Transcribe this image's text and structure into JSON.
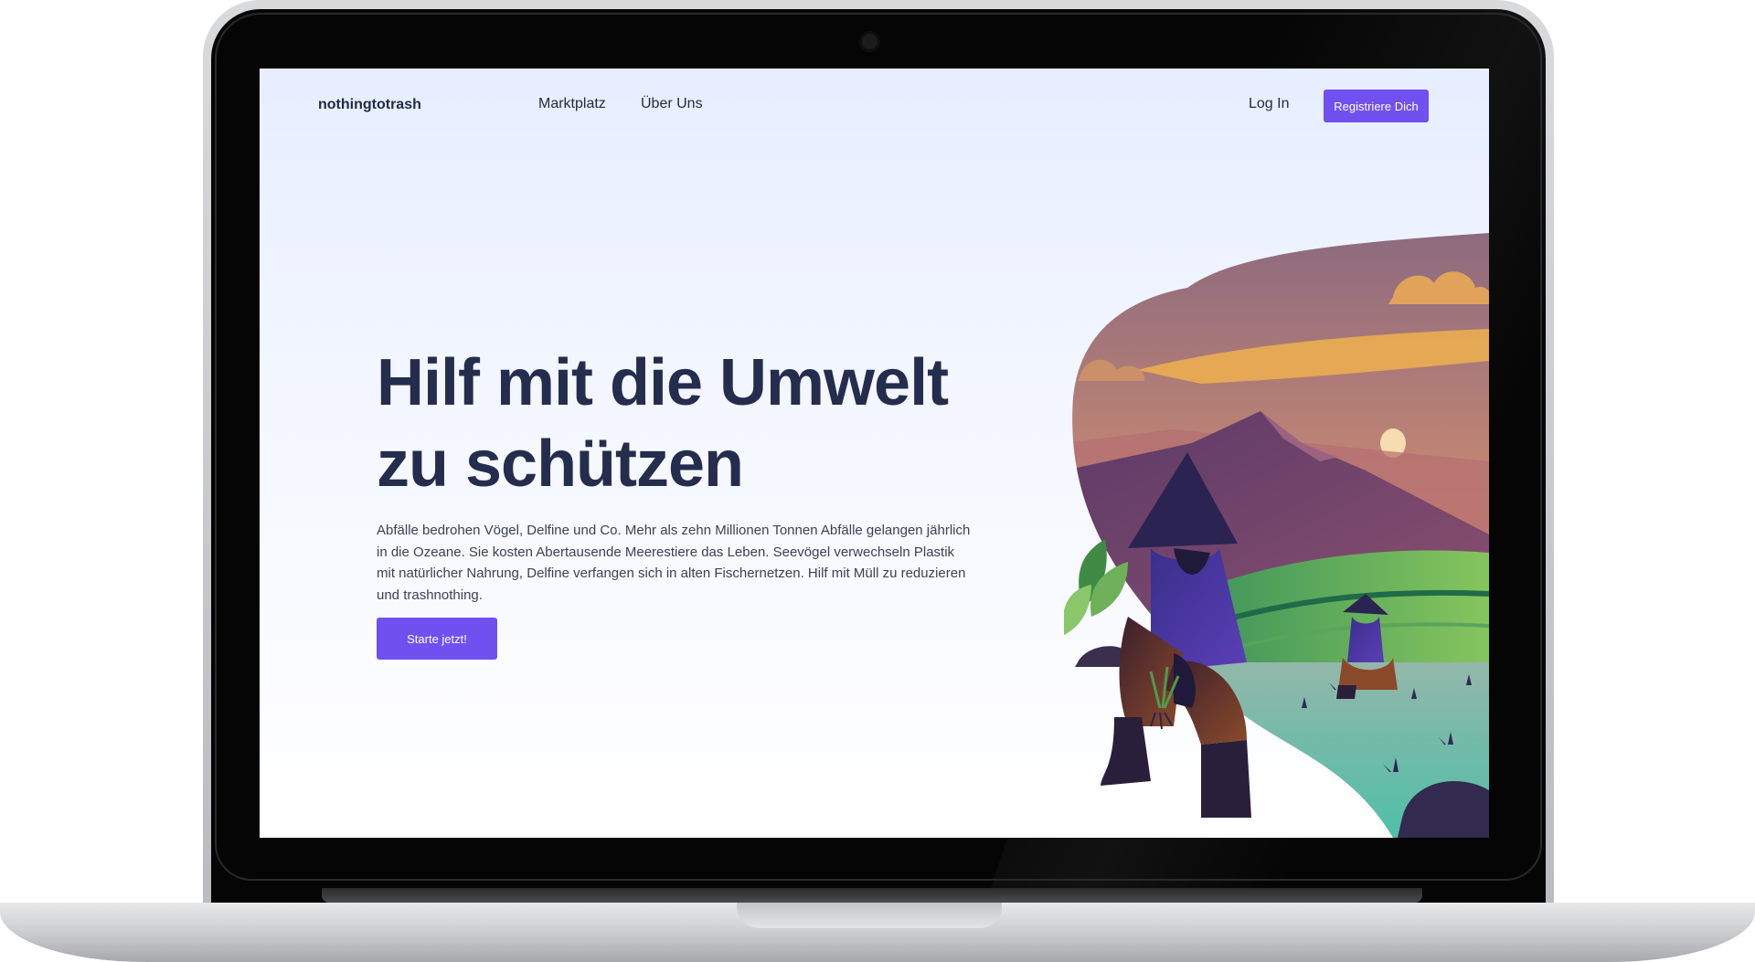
{
  "nav": {
    "brand": "nothingtotrash",
    "links": [
      "Marktplatz",
      "Über Uns"
    ],
    "login": "Log In",
    "register": "Registriere Dich"
  },
  "hero": {
    "title_line1": "Hilf mit die Umwelt",
    "title_line2": "zu schützen",
    "text": "Abfälle bedrohen Vögel, Delfine und Co. Mehr als zehn Millionen Tonnen Abfälle gelangen jährlich in die Ozeane. Sie kosten Abertausende Meerestiere das Leben. Seevögel verwechseln Plastik mit natürlicher Nahrung, Delfine verfangen sich in alten Fischernetzen. Hilf mit Müll zu reduzieren und trashnothing.",
    "cta": "Starte jetzt!"
  },
  "colors": {
    "accent": "#7051f0",
    "heading": "#242d4d",
    "background_top": "#e6eeff"
  },
  "illustration": {
    "name": "rice-field-farmers-illustration"
  }
}
